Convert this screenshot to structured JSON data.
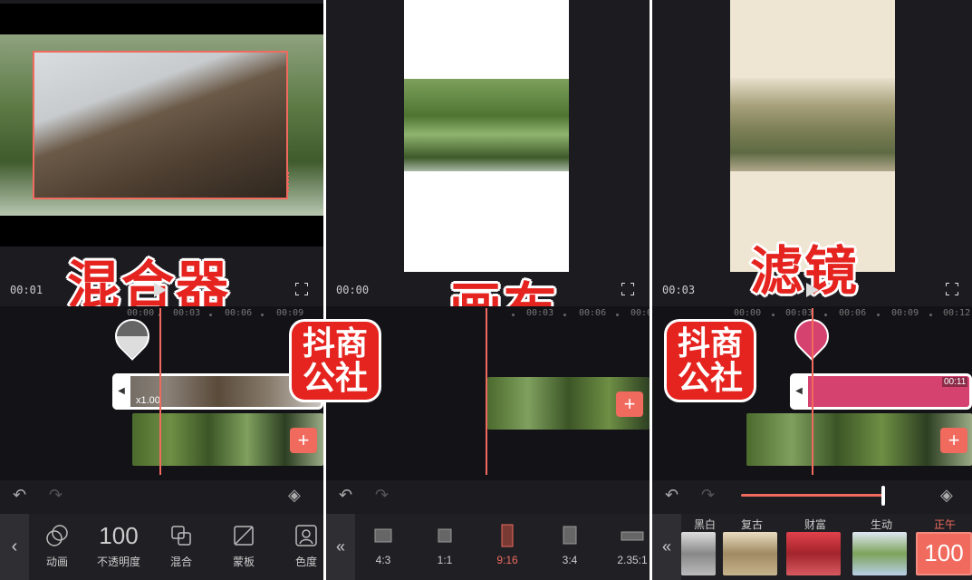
{
  "overlay_labels": [
    "混合器",
    "画布",
    "滤镜"
  ],
  "logo": {
    "line1": "抖商",
    "line2": "公社"
  },
  "panel1": {
    "time": "00:01",
    "ruler": [
      "00:00",
      "00:03",
      "00:06",
      "00:09"
    ],
    "speed": "x1.00",
    "tools": [
      {
        "icon": "animation-icon",
        "label": "动画"
      },
      {
        "icon": "opacity-value",
        "value": "100",
        "label": "不透明度"
      },
      {
        "icon": "blend-icon",
        "label": "混合"
      },
      {
        "icon": "mask-icon",
        "label": "蒙板"
      },
      {
        "icon": "chroma-key-icon",
        "label": "色度"
      }
    ]
  },
  "panel2": {
    "time": "00:00",
    "ruler": [
      "00:03",
      "00:06",
      "00:0"
    ],
    "ratios": [
      "4:3",
      "1:1",
      "9:16",
      "3:4",
      "2.35:1"
    ],
    "selected_ratio": "9:16"
  },
  "panel3": {
    "time": "00:03",
    "ruler": [
      "00:00",
      "00:03",
      "00:06",
      "00:09",
      "00:12"
    ],
    "filter_duration": "00:11",
    "filters": [
      "黑白",
      "复古",
      "财富",
      "生动",
      "正午"
    ],
    "selected_filter": "正午",
    "filter_strength": "100"
  },
  "colors": {
    "accent": "#f06a5e",
    "filter_bar": "#d5426f",
    "brand_red": "#e5231f"
  }
}
